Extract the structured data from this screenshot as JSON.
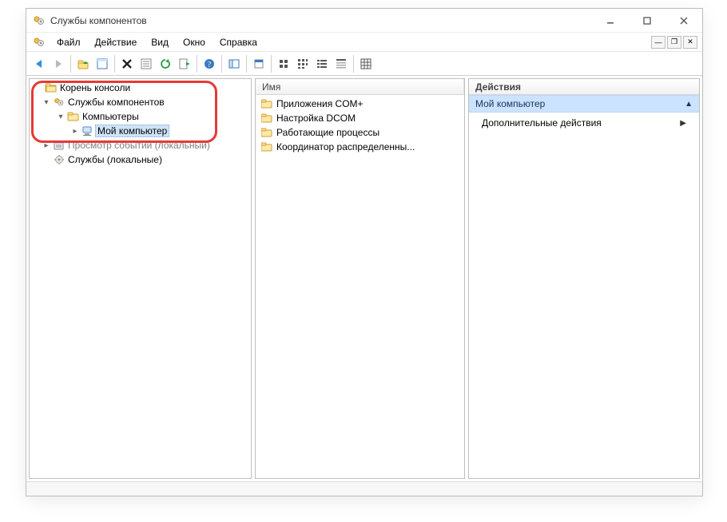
{
  "window": {
    "title": "Службы компонентов"
  },
  "menu": {
    "items": [
      "Файл",
      "Действие",
      "Вид",
      "Окно",
      "Справка"
    ]
  },
  "toolbar": {
    "buttons": [
      "back",
      "forward",
      "sep",
      "up",
      "filter",
      "sep",
      "delete",
      "properties",
      "refresh",
      "export",
      "sep",
      "help",
      "sep",
      "show-hide",
      "sep",
      "app-prop",
      "sep",
      "list-large",
      "list-small",
      "list-list",
      "list-detail",
      "sep",
      "grid"
    ]
  },
  "tree": {
    "root": {
      "label": "Корень консоли"
    },
    "componentServices": {
      "label": "Службы компонентов"
    },
    "computers": {
      "label": "Компьютеры"
    },
    "myComputer": {
      "label": "Мой компьютер"
    },
    "eventViewer": {
      "label": "Просмотр событии (локальный)"
    },
    "services": {
      "label": "Службы (локальные)"
    }
  },
  "list": {
    "header": "Имя",
    "items": [
      "Приложения COM+",
      "Настройка DCOM",
      "Работающие процессы",
      "Координатор распределенны..."
    ]
  },
  "actions": {
    "header": "Действия",
    "section_title": "Мой компьютер",
    "more_actions": "Дополнительные действия"
  }
}
